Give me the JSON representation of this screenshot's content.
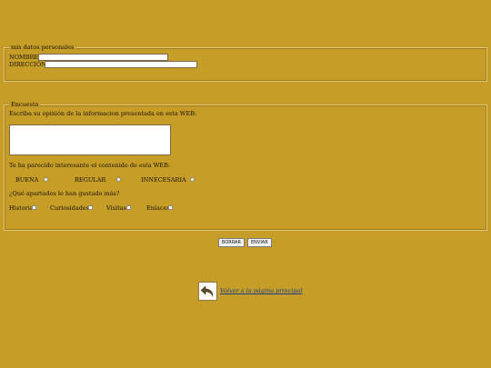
{
  "personal": {
    "legend": "mis datos personales",
    "name_label": "NOMBRE:",
    "name_value": "",
    "address_label": "DIRECCIÓN:",
    "address_value": ""
  },
  "survey": {
    "legend": "Encuesta",
    "comment_prompt": "Escriba su opinión de la informacion presentada en esta WEB:",
    "comment_value": "",
    "interest_question": "Te ha parecido interesante el contenido de esta WEB:",
    "interest_options": [
      "BUENA",
      "REGULAR",
      "INNECESARIA"
    ],
    "sections_question": "¿Qué apartados le han gustado más?",
    "section_options": [
      "Historia",
      "Curiosidades",
      "Visitas",
      "Enlaces"
    ]
  },
  "buttons": {
    "reset": "BORRAR",
    "submit": "ENVIAR"
  },
  "back": {
    "icon": "back-arrow-icon",
    "label": "Volver a la página principal"
  }
}
